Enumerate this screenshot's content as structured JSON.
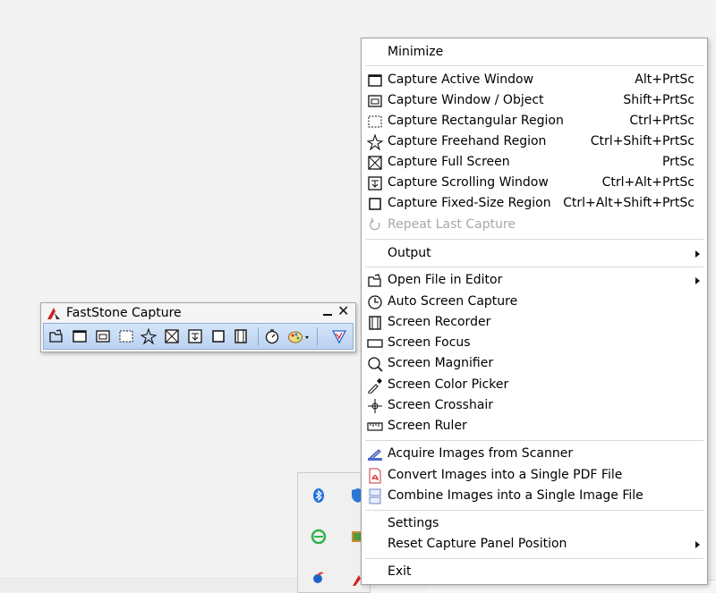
{
  "toolbar_window": {
    "title": "FastStone Capture",
    "buttons": [
      {
        "name": "open-file-icon"
      },
      {
        "name": "capture-active-window-icon"
      },
      {
        "name": "capture-window-object-icon"
      },
      {
        "name": "capture-rectangular-region-icon"
      },
      {
        "name": "capture-freehand-region-icon"
      },
      {
        "name": "capture-full-screen-icon"
      },
      {
        "name": "capture-scrolling-window-icon"
      },
      {
        "name": "capture-fixed-size-region-icon"
      },
      {
        "name": "screen-recorder-icon"
      },
      {
        "name": "delay-timer-icon"
      },
      {
        "name": "output-palette-icon"
      },
      {
        "name": "settings-menu-icon"
      }
    ]
  },
  "menu": {
    "minimize": "Minimize",
    "capture_items": [
      {
        "label": "Capture Active Window",
        "shortcut": "Alt+PrtSc"
      },
      {
        "label": "Capture Window / Object",
        "shortcut": "Shift+PrtSc"
      },
      {
        "label": "Capture Rectangular Region",
        "shortcut": "Ctrl+PrtSc"
      },
      {
        "label": "Capture Freehand Region",
        "shortcut": "Ctrl+Shift+PrtSc"
      },
      {
        "label": "Capture Full Screen",
        "shortcut": "PrtSc"
      },
      {
        "label": "Capture Scrolling Window",
        "shortcut": "Ctrl+Alt+PrtSc"
      },
      {
        "label": "Capture Fixed-Size Region",
        "shortcut": "Ctrl+Alt+Shift+PrtSc"
      },
      {
        "label": "Repeat Last Capture",
        "shortcut": "",
        "disabled": true
      }
    ],
    "output": "Output",
    "tools": [
      {
        "label": "Open File in Editor",
        "submenu": true
      },
      {
        "label": "Auto Screen Capture"
      },
      {
        "label": "Screen Recorder"
      },
      {
        "label": "Screen Focus"
      },
      {
        "label": "Screen Magnifier"
      },
      {
        "label": "Screen Color Picker"
      },
      {
        "label": "Screen Crosshair"
      },
      {
        "label": "Screen Ruler"
      }
    ],
    "image_tools": [
      {
        "label": "Acquire Images from Scanner"
      },
      {
        "label": "Convert Images into a Single PDF File"
      },
      {
        "label": "Combine Images into a Single Image File"
      }
    ],
    "settings": "Settings",
    "reset": "Reset Capture Panel Position",
    "exit": "Exit"
  },
  "tray_icons": [
    "bluetooth-icon",
    "shield-icon",
    "ie-icon",
    "photo-app-icon",
    "bird-app-icon",
    "faststone-tray-icon"
  ],
  "colors": {
    "menu_bg": "#ffffff",
    "toolbar_bg": "#c8dcf4",
    "disabled_text": "#a8a8a8",
    "faststone_red": "#d22020"
  }
}
